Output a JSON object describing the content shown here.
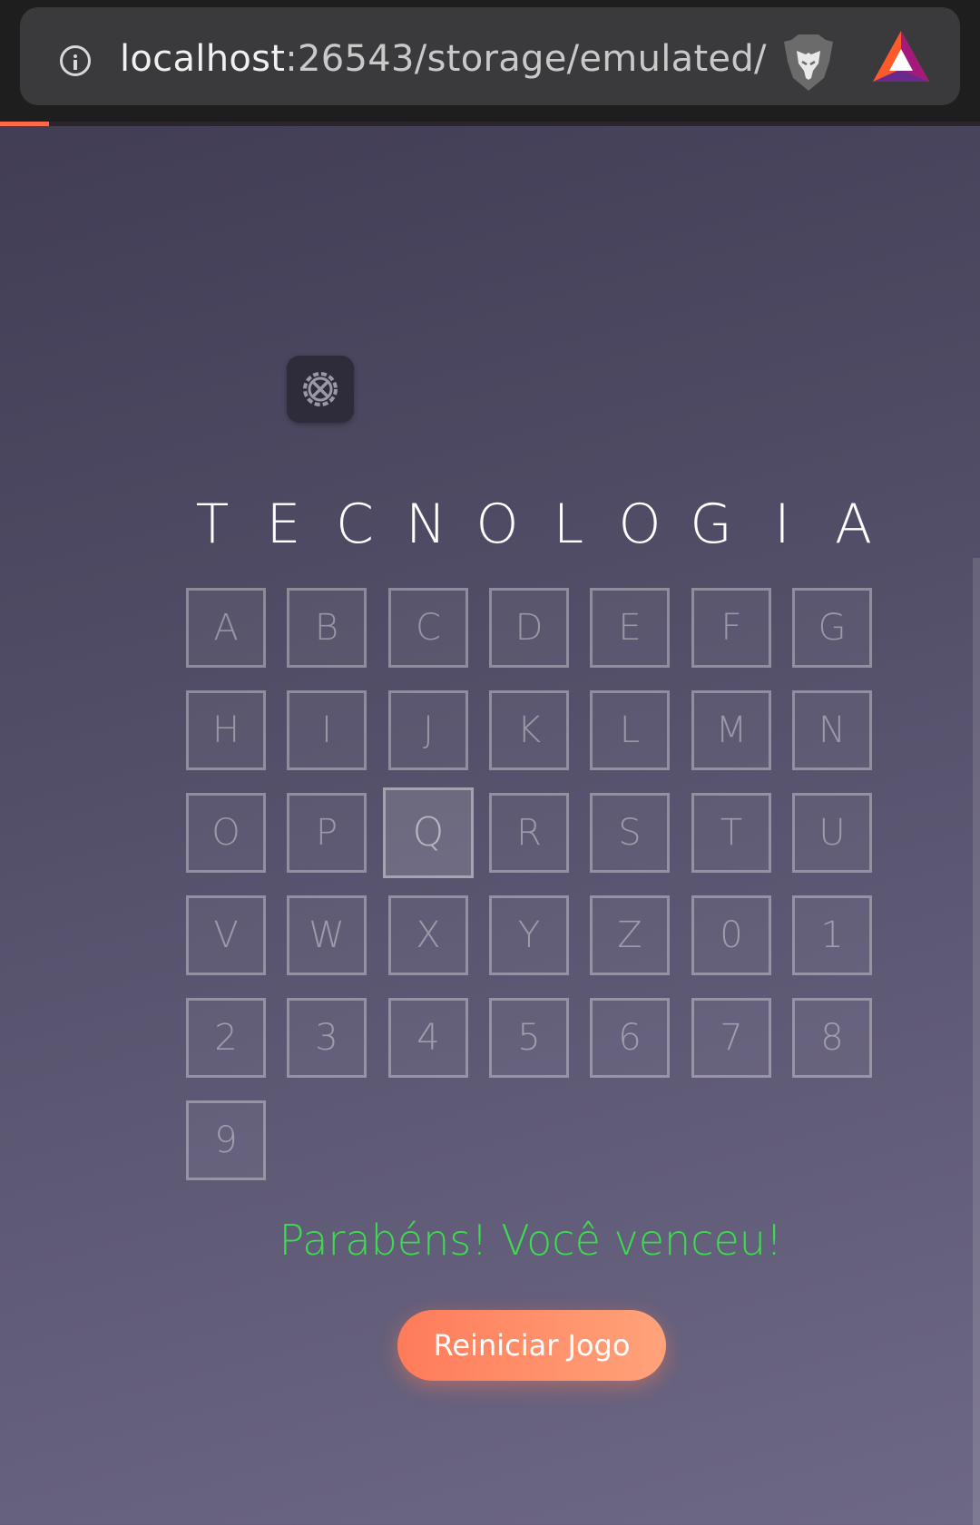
{
  "browser": {
    "url_host": "localhost",
    "url_rest": ":26543/storage/emulated/",
    "icons": [
      "info-icon",
      "brave-lion-icon",
      "brave-rewards-icon"
    ],
    "load_progress": 0.05
  },
  "game": {
    "settings_icon": "settings-tools-icon",
    "word_letters": [
      "T",
      "E",
      "C",
      "N",
      "O",
      "L",
      "O",
      "G",
      "I",
      "A"
    ],
    "keys": [
      "A",
      "B",
      "C",
      "D",
      "E",
      "F",
      "G",
      "H",
      "I",
      "J",
      "K",
      "L",
      "M",
      "N",
      "O",
      "P",
      "Q",
      "R",
      "S",
      "T",
      "U",
      "V",
      "W",
      "X",
      "Y",
      "Z",
      "0",
      "1",
      "2",
      "3",
      "4",
      "5",
      "6",
      "7",
      "8",
      "9"
    ],
    "highlighted_key": "Q",
    "win_message": "Parabéns! Você venceu!",
    "restart_label": "Reiniciar Jogo",
    "colors": {
      "win": "#3ddc4e",
      "button_start": "#ff7b5a",
      "button_end": "#ffa37a"
    }
  }
}
